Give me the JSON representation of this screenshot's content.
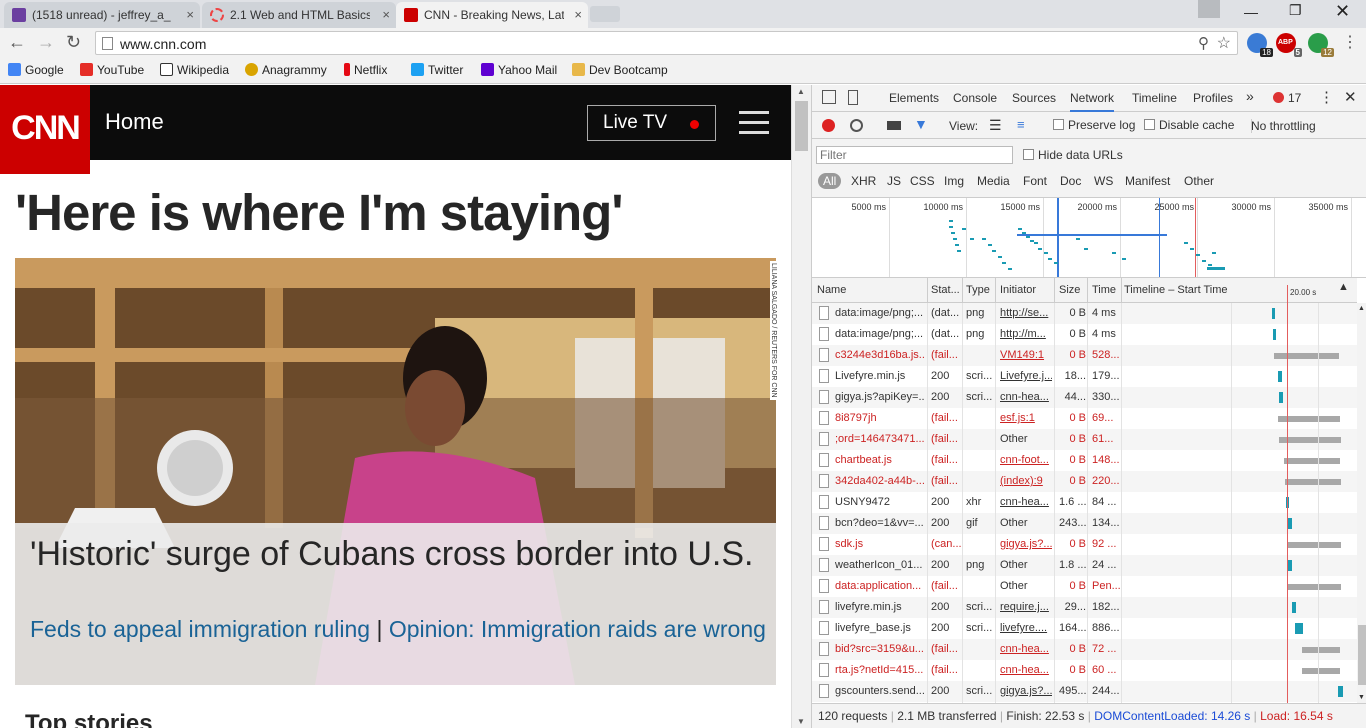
{
  "browser": {
    "tabs": [
      {
        "title": "(1518 unread) - jeffrey_a_",
        "icon_color": "#6b3fa0"
      },
      {
        "title": "2.1 Web and HTML Basics",
        "icon_color": "#e44"
      },
      {
        "title": "CNN - Breaking News, Lat",
        "icon_color": "#cc0000",
        "active": true
      }
    ],
    "close_glyph": "×",
    "url": "www.cnn.com",
    "bookmarks": [
      {
        "label": "Google",
        "icon_color": "#4285f4"
      },
      {
        "label": "YouTube",
        "icon_color": "#e52d27"
      },
      {
        "label": "Wikipedia",
        "icon_color": "#333"
      },
      {
        "label": "Anagrammy",
        "icon_color": "#d9a400"
      },
      {
        "label": "Netflix",
        "icon_color": "#e50914"
      },
      {
        "label": "Twitter",
        "icon_color": "#1da1f2"
      },
      {
        "label": "Yahoo Mail",
        "icon_color": "#5f01d1"
      },
      {
        "label": "Dev Bootcamp",
        "icon_color": "#e8b84a"
      }
    ],
    "extensions": [
      {
        "badge": "18",
        "color": "#3a7bd5",
        "badge_color": "#222"
      },
      {
        "badge": "5",
        "color": "#c00",
        "badge_color": "#666",
        "label": "ABP"
      },
      {
        "badge": "12",
        "color": "#2a9d4a",
        "badge_color": "#9a7b3a"
      }
    ]
  },
  "cnn": {
    "logo": "CNN",
    "home": "Home",
    "live_tv": "Live TV",
    "headline": "'Here is where I'm staying'",
    "photo_credit": "LILIANA SALGADO / REUTERS FOR CNN",
    "caption_title": "'Historic' surge of Cubans cross border into U.S.",
    "caption_link1": "Feds to appeal immigration ruling",
    "caption_sep": "|",
    "caption_link2": "Opinion: Immigration raids are wrong",
    "top_stories": "Top stories",
    "brand_red": "#cc0000"
  },
  "devtools": {
    "tabs": [
      "Elements",
      "Console",
      "Sources",
      "Network",
      "Timeline",
      "Profiles"
    ],
    "active_tab": "Network",
    "more_glyph": "»",
    "error_count": "17",
    "view_label": "View:",
    "preserve_log": "Preserve log",
    "disable_cache": "Disable cache",
    "throttling": "No throttling",
    "filter_placeholder": "Filter",
    "hide_data_urls": "Hide data URLs",
    "filter_types": [
      "All",
      "XHR",
      "JS",
      "CSS",
      "Img",
      "Media",
      "Font",
      "Doc",
      "WS",
      "Manifest",
      "Other"
    ],
    "overview_ticks": [
      "5000 ms",
      "10000 ms",
      "15000 ms",
      "20000 ms",
      "25000 ms",
      "30000 ms",
      "35000 ms"
    ],
    "columns": [
      "Name",
      "Stat...",
      "Type",
      "Initiator",
      "Size",
      "Time",
      "Timeline – Start Time"
    ],
    "timeline_label": "20.00 s",
    "rows": [
      {
        "name": "data:image/png;...",
        "status": "(dat...",
        "type": "png",
        "initiator": "http://se...",
        "size": "0 B",
        "time": "4 ms",
        "fail": false,
        "init_link": true
      },
      {
        "name": "data:image/png;...",
        "status": "(dat...",
        "type": "png",
        "initiator": "http://m...",
        "size": "0 B",
        "time": "4 ms",
        "fail": false,
        "init_link": true
      },
      {
        "name": "c3244e3d16ba.js...",
        "status": "(fail...",
        "type": "",
        "initiator": "VM149:1",
        "size": "0 B",
        "time": "528...",
        "fail": true,
        "init_link": true
      },
      {
        "name": "Livefyre.min.js",
        "status": "200",
        "type": "scri...",
        "initiator": "Livefyre.j...",
        "size": "18...",
        "time": "179...",
        "fail": false,
        "init_link": true
      },
      {
        "name": "gigya.js?apiKey=...",
        "status": "200",
        "type": "scri...",
        "initiator": "cnn-hea...",
        "size": "44...",
        "time": "330...",
        "fail": false,
        "init_link": true
      },
      {
        "name": "8i8797jh",
        "status": "(fail...",
        "type": "",
        "initiator": "esf.js:1",
        "size": "0 B",
        "time": "69...",
        "fail": true,
        "init_link": true
      },
      {
        "name": ";ord=146473471...",
        "status": "(fail...",
        "type": "",
        "initiator": "Other",
        "size": "0 B",
        "time": "61...",
        "fail": true,
        "init_link": false
      },
      {
        "name": "chartbeat.js",
        "status": "(fail...",
        "type": "",
        "initiator": "cnn-foot...",
        "size": "0 B",
        "time": "148...",
        "fail": true,
        "init_link": true
      },
      {
        "name": "342da402-a44b-...",
        "status": "(fail...",
        "type": "",
        "initiator": "(index):9",
        "size": "0 B",
        "time": "220...",
        "fail": true,
        "init_link": true
      },
      {
        "name": "USNY9472",
        "status": "200",
        "type": "xhr",
        "initiator": "cnn-hea...",
        "size": "1.6 ...",
        "time": "84 ...",
        "fail": false,
        "init_link": true
      },
      {
        "name": "bcn?deo=1&vv=...",
        "status": "200",
        "type": "gif",
        "initiator": "Other",
        "size": "243...",
        "time": "134...",
        "fail": false,
        "init_link": false
      },
      {
        "name": "sdk.js",
        "status": "(can...",
        "type": "",
        "initiator": "gigya.js?...",
        "size": "0 B",
        "time": "92 ...",
        "fail": true,
        "init_link": true
      },
      {
        "name": "weatherIcon_01...",
        "status": "200",
        "type": "png",
        "initiator": "Other",
        "size": "1.8 ...",
        "time": "24 ...",
        "fail": false,
        "init_link": false
      },
      {
        "name": "data:application...",
        "status": "(fail...",
        "type": "",
        "initiator": "Other",
        "size": "0 B",
        "time": "Pen...",
        "fail": true,
        "init_link": false
      },
      {
        "name": "livefyre.min.js",
        "status": "200",
        "type": "scri...",
        "initiator": "require.j...",
        "size": "29...",
        "time": "182...",
        "fail": false,
        "init_link": true
      },
      {
        "name": "livefyre_base.js",
        "status": "200",
        "type": "scri...",
        "initiator": "livefyre....",
        "size": "164...",
        "time": "886...",
        "fail": false,
        "init_link": true
      },
      {
        "name": "bid?src=3159&u...",
        "status": "(fail...",
        "type": "",
        "initiator": "cnn-hea...",
        "size": "0 B",
        "time": "72 ...",
        "fail": true,
        "init_link": true
      },
      {
        "name": "rta.js?netId=415...",
        "status": "(fail...",
        "type": "",
        "initiator": "cnn-hea...",
        "size": "0 B",
        "time": "60 ...",
        "fail": true,
        "init_link": true
      },
      {
        "name": "gscounters.send...",
        "status": "200",
        "type": "scri...",
        "initiator": "gigya.js?...",
        "size": "495...",
        "time": "244...",
        "fail": false,
        "init_link": true
      }
    ],
    "status_bar": {
      "requests": "120 requests",
      "transferred": "2.1 MB transferred",
      "finish": "Finish: 22.53 s",
      "dcl": "DOMContentLoaded: 14.26 s",
      "load": "Load: 16.54 s"
    }
  }
}
